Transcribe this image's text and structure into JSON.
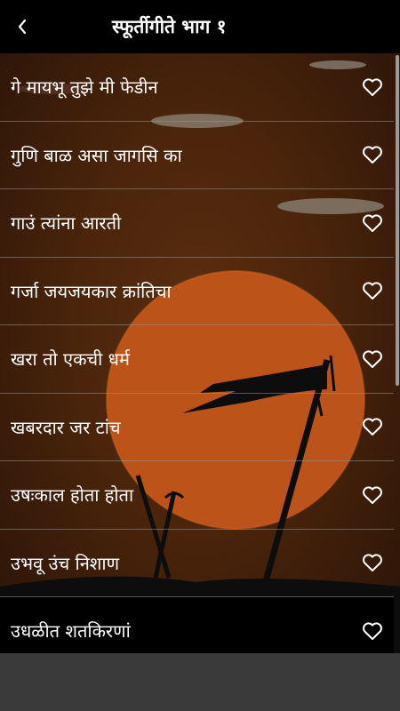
{
  "app_bar": {
    "title": "स्फूर्तीगीते भाग १",
    "back_icon": "chevron-left-icon"
  },
  "songs": [
    {
      "label": "गे मायभू तुझे मी फेडीन",
      "icon": "heart-outline-icon"
    },
    {
      "label": "गुणि बाळ असा जागसि का",
      "icon": "heart-outline-icon"
    },
    {
      "label": "गाउं त्यांना आरती",
      "icon": "heart-outline-icon"
    },
    {
      "label": "गर्जा जयजयकार क्रांतिचा",
      "icon": "heart-outline-icon"
    },
    {
      "label": "खरा तो एकची धर्म",
      "icon": "heart-outline-icon"
    },
    {
      "label": "खबरदार जर टांच",
      "icon": "heart-outline-icon"
    },
    {
      "label": "उषःकाल होता होता",
      "icon": "heart-outline-icon"
    },
    {
      "label": "उभवू उंच निशाण",
      "icon": "heart-outline-icon"
    },
    {
      "label": "उधळीत शतकिरणां",
      "icon": "heart-outline-icon"
    }
  ],
  "colors": {
    "app_bar": "#000000",
    "sun": "#c2561b",
    "silhouette": "#0d0d0d"
  }
}
